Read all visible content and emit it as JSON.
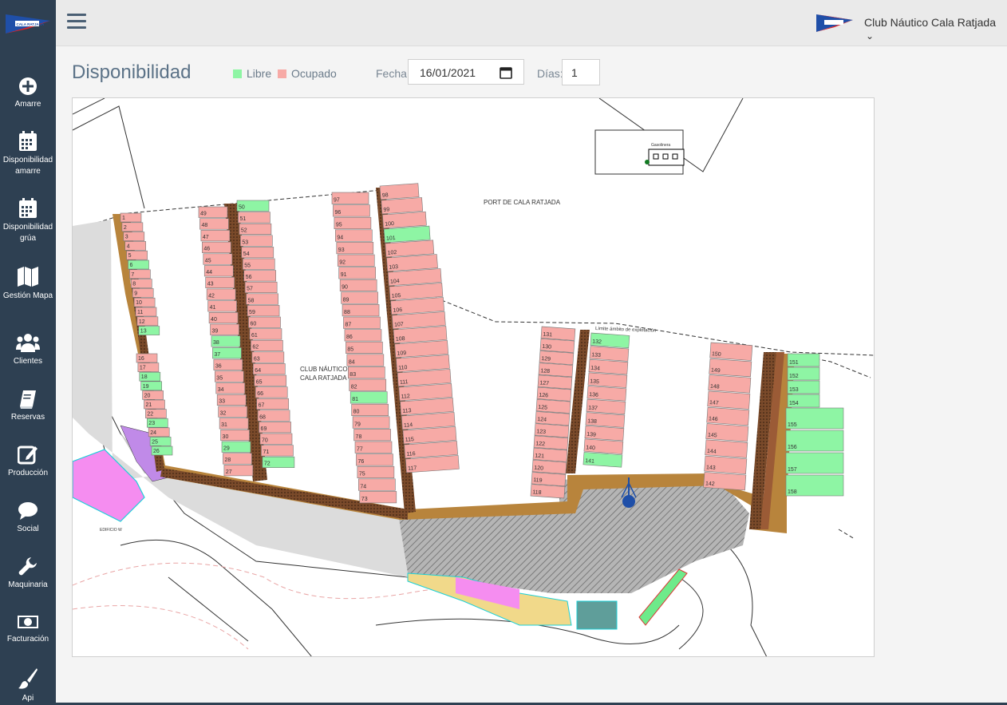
{
  "sidebar": {
    "logo_text": "CN CALA RATJADA",
    "items": [
      {
        "icon": "plus-circle-icon",
        "label": "Amarre"
      },
      {
        "icon": "calendar-icon",
        "label": "Disponibilidad amarre"
      },
      {
        "icon": "calendar-icon",
        "label": "Disponibilidad grúa"
      },
      {
        "icon": "map-icon",
        "label": "Gestión Mapa"
      },
      {
        "icon": "users-icon",
        "label": "Clientes"
      },
      {
        "icon": "book-icon",
        "label": "Reservas"
      },
      {
        "icon": "edit-icon",
        "label": "Producción"
      },
      {
        "icon": "chat-bubble-icon",
        "label": "Social"
      },
      {
        "icon": "wrench-icon",
        "label": "Maquinaria"
      },
      {
        "icon": "money-bill-icon",
        "label": "Facturación"
      },
      {
        "icon": "brush-icon",
        "label": "Api"
      }
    ]
  },
  "topbar": {
    "club_name": "Club Náutico Cala Ratjada",
    "chevron": "⌄"
  },
  "header": {
    "title": "Disponibilidad",
    "legend_free": "Libre",
    "legend_occupied": "Ocupado",
    "date_label": "Fecha:",
    "date_value": "16/01/2021",
    "days_label": "Días:",
    "days_value": "1"
  },
  "colors": {
    "sidebar_bg": "#2e4052",
    "free": "#8ef5a4",
    "occupied": "#f7aaa6",
    "pontoon": "#7a4a2a",
    "quay": "#b8843c"
  },
  "map": {
    "port_label": "PORT DE CALA RATJADA",
    "club_label_1": "CLUB NÁUTICO",
    "club_label_2": "CALA RATJADA",
    "limit_label": "Límite ámbito de explotación",
    "building_label": "EDIFICIO W",
    "gas_label": "Gasolinera",
    "free_berths": [
      6,
      13,
      18,
      19,
      23,
      25,
      26,
      29,
      37,
      38,
      50,
      72,
      81,
      101,
      132,
      141,
      151,
      152,
      153,
      154,
      155,
      156,
      157,
      158
    ]
  }
}
